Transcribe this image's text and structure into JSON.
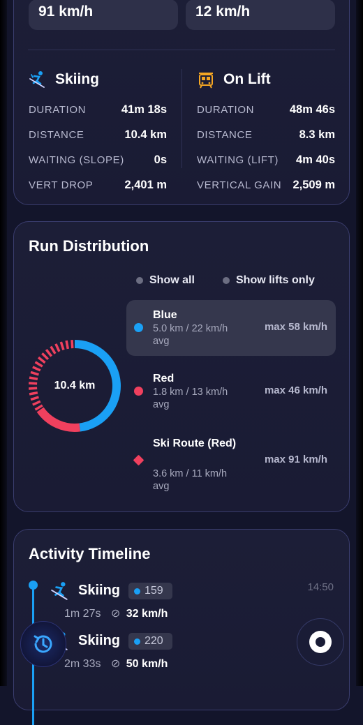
{
  "speeds": {
    "left": "91 km/h",
    "right": "12 km/h"
  },
  "skiing": {
    "title": "Skiing",
    "icon": "skier-icon",
    "rows": [
      {
        "label": "DURATION",
        "value": "41m 18s"
      },
      {
        "label": "DISTANCE",
        "value": "10.4 km"
      },
      {
        "label": "WAITING (SLOPE)",
        "value": "0s"
      },
      {
        "label": "VERT DROP",
        "value": "2,401 m"
      }
    ]
  },
  "lift": {
    "title": "On Lift",
    "icon": "lift-icon",
    "rows": [
      {
        "label": "DURATION",
        "value": "48m 46s"
      },
      {
        "label": "DISTANCE",
        "value": "8.3 km"
      },
      {
        "label": "WAITING (LIFT)",
        "value": "4m 40s"
      },
      {
        "label": "VERTICAL GAIN",
        "value": "2,509 m"
      }
    ]
  },
  "distribution": {
    "title": "Run Distribution",
    "show_all": "Show all",
    "show_lifts": "Show lifts only",
    "total": "10.4 km",
    "runs": [
      {
        "name": "Blue",
        "sub": "5.0 km / 22 km/h avg",
        "max": "max 58 km/h",
        "color": "#1aa0f5",
        "km": 5.0
      },
      {
        "name": "Red",
        "sub": "1.8 km / 13 km/h avg",
        "max": "max 46 km/h",
        "color": "#f0405e",
        "km": 1.8
      },
      {
        "name": "Ski Route (Red)",
        "sub": "3.6 km / 11 km/h avg",
        "max": "max 91 km/h",
        "color": "#f0405e",
        "km": 3.6
      }
    ]
  },
  "timeline": {
    "title": "Activity Timeline",
    "items": [
      {
        "name": "Skiing",
        "badge": "159",
        "duration": "1m 27s",
        "speed": "32 km/h",
        "time": "14:50"
      },
      {
        "name": "Skiing",
        "badge": "220",
        "duration": "2m 33s",
        "speed": "50 km/h",
        "time": ""
      }
    ]
  }
}
